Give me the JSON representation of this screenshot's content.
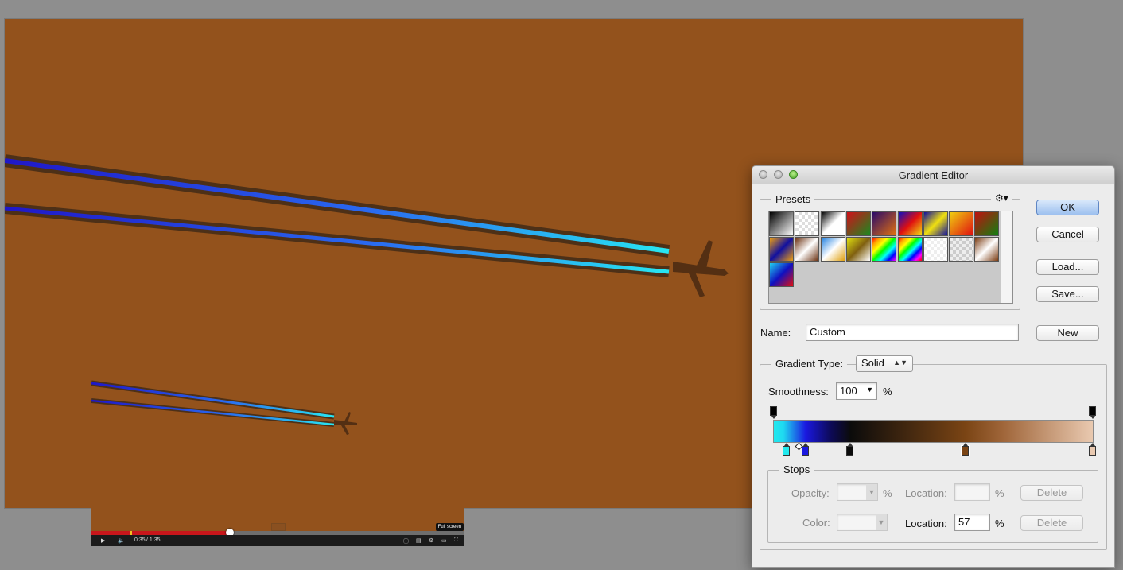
{
  "dialog": {
    "title": "Gradient Editor",
    "buttons": {
      "ok": "OK",
      "cancel": "Cancel",
      "load": "Load...",
      "save": "Save...",
      "new": "New"
    },
    "presets": {
      "label": "Presets",
      "menu_icon": "gear-icon",
      "swatches": [
        "linear-gradient(135deg,#000,#fff)",
        "repeating-conic-gradient(#ddd 0 25%,#fff 0 50%) 0 0/8px 8px",
        "linear-gradient(135deg,#000,#fff,#fff)",
        "linear-gradient(135deg,#d0101a,#1a8a20)",
        "linear-gradient(135deg,#2a0a6a,#e07010)",
        "linear-gradient(135deg,#1010c0,#e01010,#f0e010)",
        "linear-gradient(135deg,#1010a0,#f0e010,#1010a0)",
        "linear-gradient(135deg,#f0d010,#e01010)",
        "linear-gradient(135deg,#c01010,#108010)",
        "linear-gradient(135deg,#f0a010,#1010a0,#f0a010)",
        "linear-gradient(135deg,#6a3010,#fff,#6a3010)",
        "linear-gradient(135deg,#2080e0,#fff,#e0a010)",
        "linear-gradient(135deg,#e0e010,#806010,#fff)",
        "linear-gradient(135deg,red,orange,yellow,lime,cyan,blue,magenta)",
        "linear-gradient(135deg,red,orange,yellow,lime,cyan,blue,magenta,red)",
        "repeating-conic-gradient(#eee 0 25%,#fff 0 50%) 0 0/8px 8px",
        "repeating-conic-gradient(#ccc 0 25%,#eee 0 50%) 0 0/8px 8px",
        "linear-gradient(135deg,#7a3a10,#fff,#7a3a10)",
        "linear-gradient(135deg,#20d0f0,#1010c0,#e01010)"
      ]
    },
    "name_label": "Name:",
    "name_value": "Custom",
    "gradient_type_label": "Gradient Type:",
    "gradient_type_value": "Solid",
    "smoothness_label": "Smoothness:",
    "smoothness_value": "100",
    "percent": "%",
    "stops": {
      "label": "Stops",
      "opacity_label": "Opacity:",
      "opacity_value": "",
      "opacity_location_label": "Location:",
      "opacity_location_value": "",
      "color_label": "Color:",
      "color_location_label": "Location:",
      "color_location_value": "57",
      "delete": "Delete"
    },
    "opacity_stops": [
      {
        "location": 0,
        "color": "#000000"
      },
      {
        "location": 100,
        "color": "#000000"
      }
    ],
    "color_stops": [
      {
        "location": 4,
        "color": "#22e9ee"
      },
      {
        "location": 10,
        "color": "#1a18e0"
      },
      {
        "location": 24,
        "color": "#0b0b0b"
      },
      {
        "location": 60,
        "color": "#7a4414",
        "selected": true
      },
      {
        "location": 100,
        "color": "#e9c9b0"
      }
    ]
  },
  "video": {
    "current_time": "0:35",
    "duration": "/ 1:35",
    "progress": 0.37,
    "tooltip": "Full screen"
  },
  "colors": {
    "canvas": "#93521c",
    "trail_glow": "#22d8f2",
    "trail_core": "#1a18e0"
  }
}
